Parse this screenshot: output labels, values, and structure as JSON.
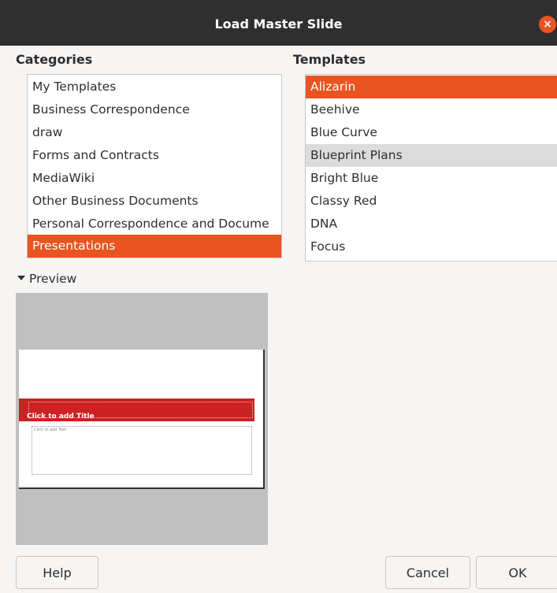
{
  "window": {
    "title": "Load Master Slide"
  },
  "categories": {
    "label": "Categories",
    "items": [
      {
        "label": "My Templates",
        "selected": false
      },
      {
        "label": "Business Correspondence",
        "selected": false
      },
      {
        "label": "draw",
        "selected": false
      },
      {
        "label": "Forms and Contracts",
        "selected": false
      },
      {
        "label": "MediaWiki",
        "selected": false
      },
      {
        "label": "Other Business Documents",
        "selected": false
      },
      {
        "label": "Personal Correspondence and Docume",
        "selected": false
      },
      {
        "label": "Presentations",
        "selected": true
      }
    ]
  },
  "templates": {
    "label": "Templates",
    "items": [
      {
        "label": "Alizarin",
        "selected": true
      },
      {
        "label": "Beehive",
        "selected": false
      },
      {
        "label": "Blue Curve",
        "selected": false
      },
      {
        "label": "Blueprint Plans",
        "selected": false,
        "hovered": true
      },
      {
        "label": "Bright Blue",
        "selected": false
      },
      {
        "label": "Classy Red",
        "selected": false
      },
      {
        "label": "DNA",
        "selected": false
      },
      {
        "label": "Focus",
        "selected": false
      }
    ]
  },
  "preview": {
    "label": "Preview",
    "slide_title": "Click to add Title",
    "slide_text": "Click to add Text"
  },
  "buttons": {
    "help": "Help",
    "cancel": "Cancel",
    "ok": "OK"
  },
  "colors": {
    "accent": "#e95420",
    "titlebar": "#2f2f2f",
    "slide_band": "#cc2222"
  }
}
